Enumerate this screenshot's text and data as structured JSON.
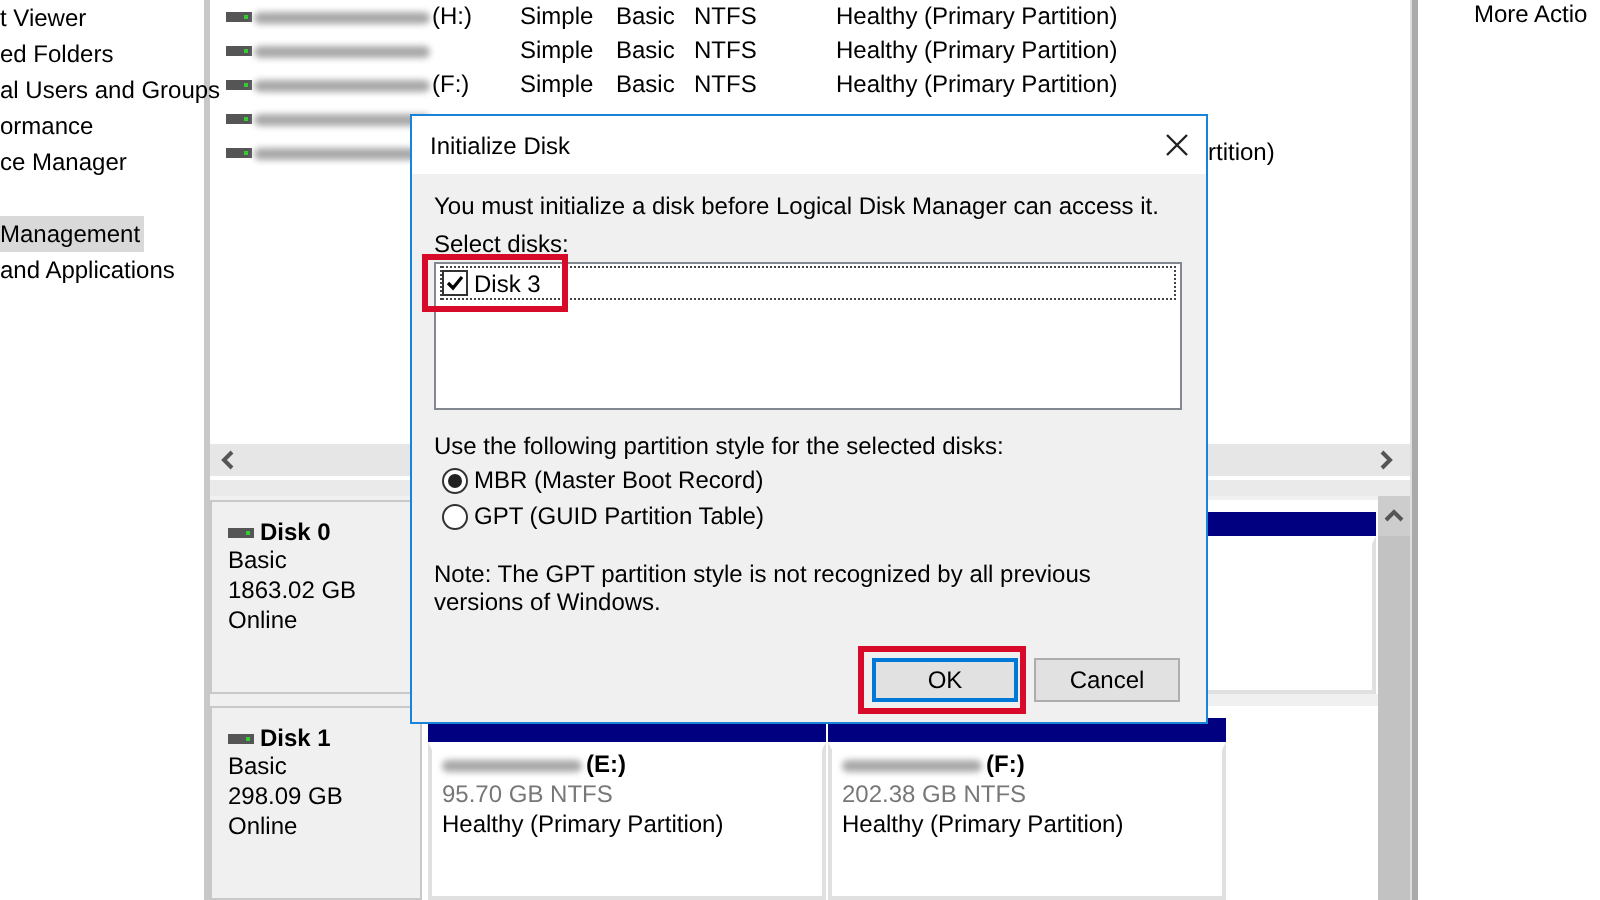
{
  "nav_tree": {
    "items": [
      {
        "label": "t Viewer",
        "selected": false
      },
      {
        "label": "ed Folders",
        "selected": false
      },
      {
        "label": "al Users and Groups",
        "selected": false
      },
      {
        "label": "ormance",
        "selected": false
      },
      {
        "label": "ce Manager",
        "selected": false
      },
      {
        "label": "Management",
        "selected": true
      },
      {
        "label": "and Applications",
        "selected": false
      }
    ]
  },
  "volumes": {
    "rows": [
      {
        "redacted": true,
        "drive": "(H:)",
        "layout": "Simple",
        "type": "Basic",
        "file_system": "NTFS",
        "status": "Healthy (Primary Partition)"
      },
      {
        "redacted": true,
        "layout": "Simple",
        "type": "Basic",
        "file_system": "NTFS",
        "status": "Healthy (Primary Partition)"
      },
      {
        "redacted": true,
        "drive": "(F:)",
        "layout": "Simple",
        "type": "Basic",
        "file_system": "NTFS",
        "status": "Healthy (Primary Partition)"
      },
      {
        "redacted": true
      },
      {
        "redacted": true,
        "status": "rtition)"
      }
    ]
  },
  "disks": [
    {
      "name": "Disk 0",
      "type": "Basic",
      "size": "1863.02 GB",
      "state": "Online"
    },
    {
      "name": "Disk 1",
      "type": "Basic",
      "size": "298.09 GB",
      "state": "Online",
      "partitions": [
        {
          "drive": "(E:)",
          "size": "95.70 GB NTFS",
          "status": "Healthy (Primary Partition)"
        },
        {
          "drive": "(F:)",
          "size": "202.38 GB NTFS",
          "status": "Healthy (Primary Partition)"
        }
      ]
    }
  ],
  "actions": {
    "items": [
      "More Actio"
    ]
  },
  "dialog": {
    "title": "Initialize Disk",
    "message": "You must initialize a disk before Logical Disk Manager can access it.",
    "select_label": "Select disks:",
    "disks": [
      {
        "label": "Disk 3",
        "checked": true,
        "highlighted": true
      }
    ],
    "style_label": "Use the following partition style for the selected disks:",
    "styles": [
      {
        "label": "MBR (Master Boot Record)",
        "selected": true
      },
      {
        "label": "GPT (GUID Partition Table)",
        "selected": false
      }
    ],
    "note": "Note: The GPT partition style is not recognized by all previous versions of Windows.",
    "buttons": [
      {
        "label": "OK",
        "default": true,
        "highlighted": true
      },
      {
        "label": "Cancel",
        "default": false,
        "highlighted": false
      }
    ]
  }
}
